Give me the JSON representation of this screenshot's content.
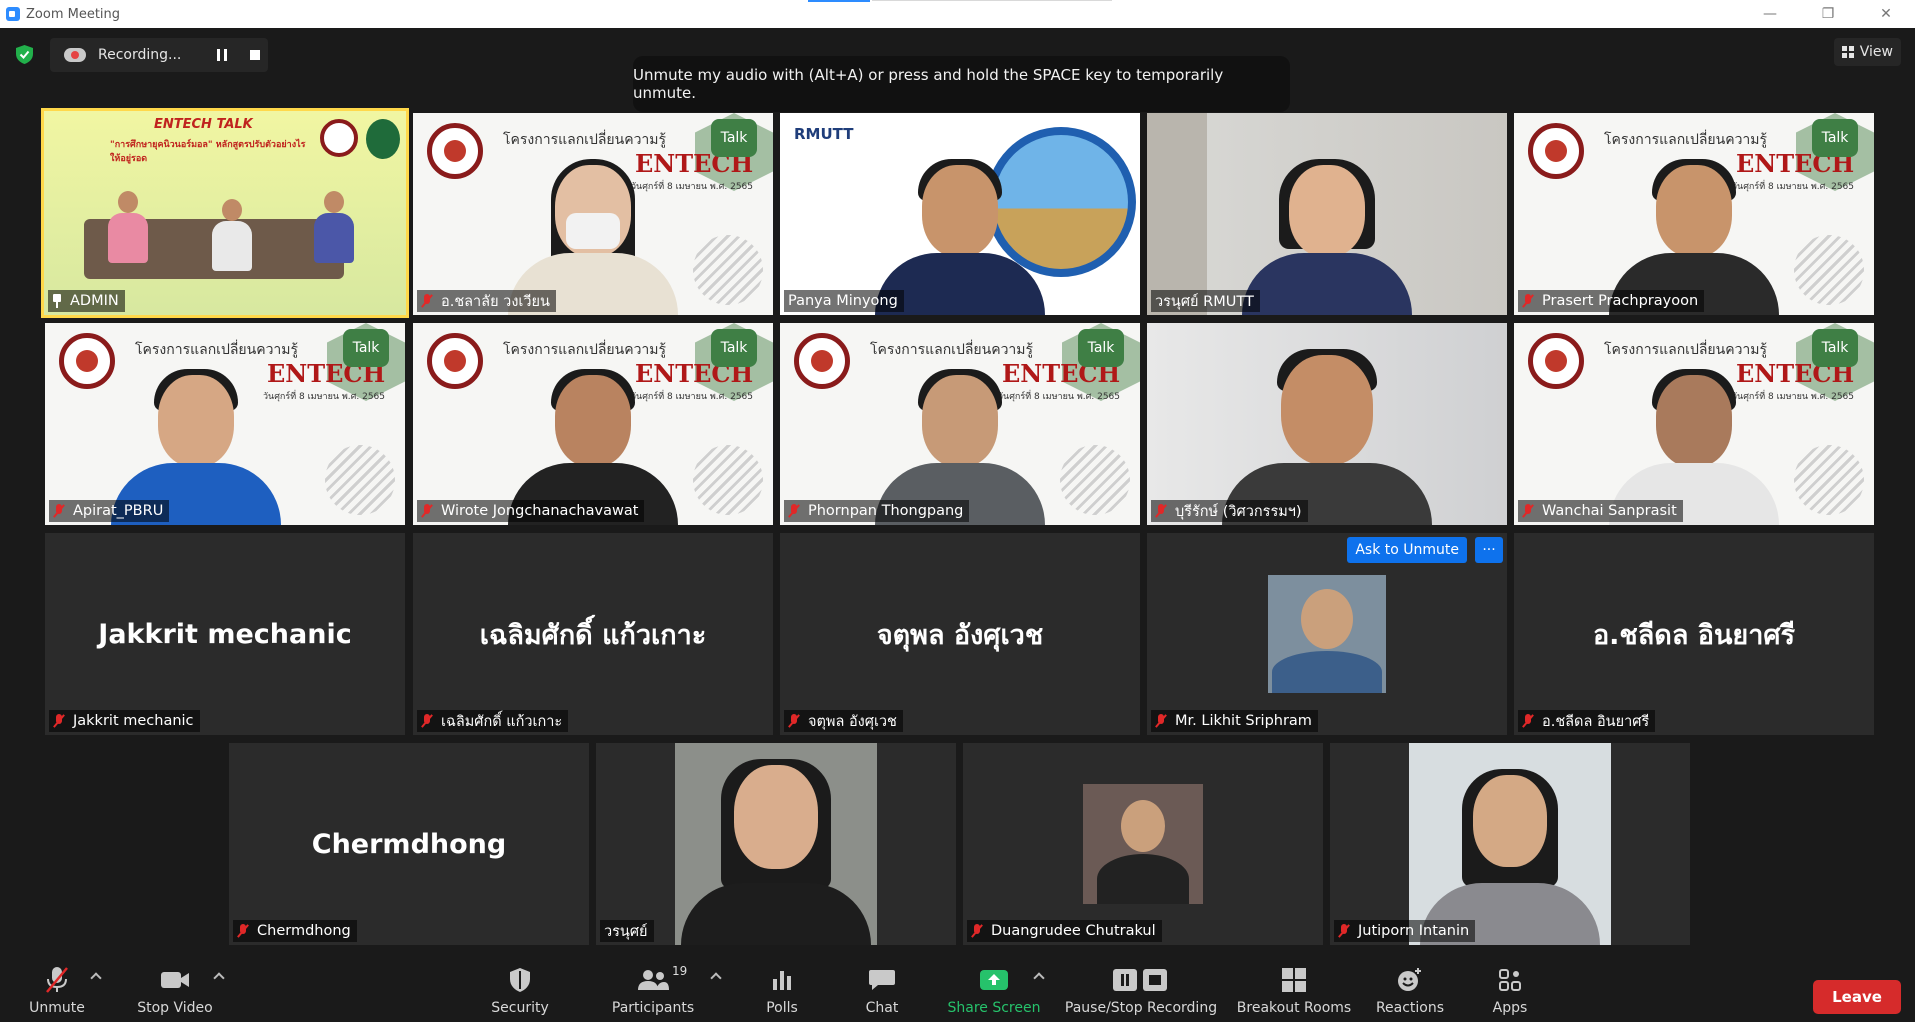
{
  "window": {
    "title": "Zoom Meeting",
    "minimize": "—",
    "maximize": "❐",
    "close": "✕"
  },
  "recording": {
    "status": "Recording..."
  },
  "view": {
    "label": "View"
  },
  "tooltip": {
    "text": "Unmute my audio with (Alt+A) or press and hold the SPACE key to temporarily unmute."
  },
  "banner": {
    "project": "โครงการแลกเปลี่ยนความรู้",
    "entech": "ENTECH",
    "date": "วันศุกร์ที่ 8 เมษายน พ.ศ. 2565",
    "talk": "Talk",
    "entech_talk_title": "ENTECH TALK",
    "entech_talk_sub": "\"การศึกษายุคนิวนอร์มอล\" หลักสูตรปรับตัวอย่างไรให้อยู่รอด",
    "rmutt": "RMUTT"
  },
  "participants": [
    {
      "name": "ADMIN",
      "muted": false,
      "pinned": true
    },
    {
      "name": "อ.ชลาลัย วงเวียน",
      "muted": true
    },
    {
      "name": "Panya Minyong",
      "muted": false
    },
    {
      "name": "วรนุศย์ RMUTT",
      "muted": false
    },
    {
      "name": "Prasert Prachprayoon",
      "muted": true
    },
    {
      "name": "Apirat_PBRU",
      "muted": true
    },
    {
      "name": "Wirote Jongchanachavawat",
      "muted": true
    },
    {
      "name": "Phornpan Thongpang",
      "muted": true
    },
    {
      "name": "บุรีรักษ์ (วิศวกรรมฯ)",
      "muted": true
    },
    {
      "name": "Wanchai Sanprasit",
      "muted": true
    },
    {
      "name": "Jakkrit mechanic",
      "muted": true,
      "display": "Jakkrit mechanic"
    },
    {
      "name": "เฉลิมศักดิ์ แก้วเกาะ",
      "muted": true,
      "display": "เฉลิมศักดิ์ แก้วเกาะ"
    },
    {
      "name": "จตุพล อังศุเวช",
      "muted": true,
      "display": "จตุพล อังศุเวช"
    },
    {
      "name": "Mr. Likhit Sriphram",
      "muted": true
    },
    {
      "name": "อ.ชลีดล  อินยาศรี",
      "muted": true,
      "display": "อ.ชลีดล  อินยาศรี"
    },
    {
      "name": "Chermdhong",
      "muted": true,
      "display": "Chermdhong"
    },
    {
      "name": "วรนุศย์",
      "muted": false
    },
    {
      "name": "Duangrudee Chutrakul",
      "muted": true
    },
    {
      "name": "Jutiporn Intanin",
      "muted": true
    }
  ],
  "tile_actions": {
    "ask_unmute": "Ask to Unmute",
    "more": "···"
  },
  "toolbar": {
    "unmute": "Unmute",
    "stop_video": "Stop Video",
    "security": "Security",
    "participants": "Participants",
    "participants_count": "19",
    "polls": "Polls",
    "chat": "Chat",
    "share_screen": "Share Screen",
    "pause_stop_recording": "Pause/Stop Recording",
    "breakout_rooms": "Breakout Rooms",
    "reactions": "Reactions",
    "apps": "Apps",
    "leave": "Leave"
  },
  "colors": {
    "accent": "#2d8cff",
    "active_speaker": "#ffd84a",
    "muted": "#e02828",
    "share": "#26c26b",
    "leave": "#d62b2b"
  }
}
